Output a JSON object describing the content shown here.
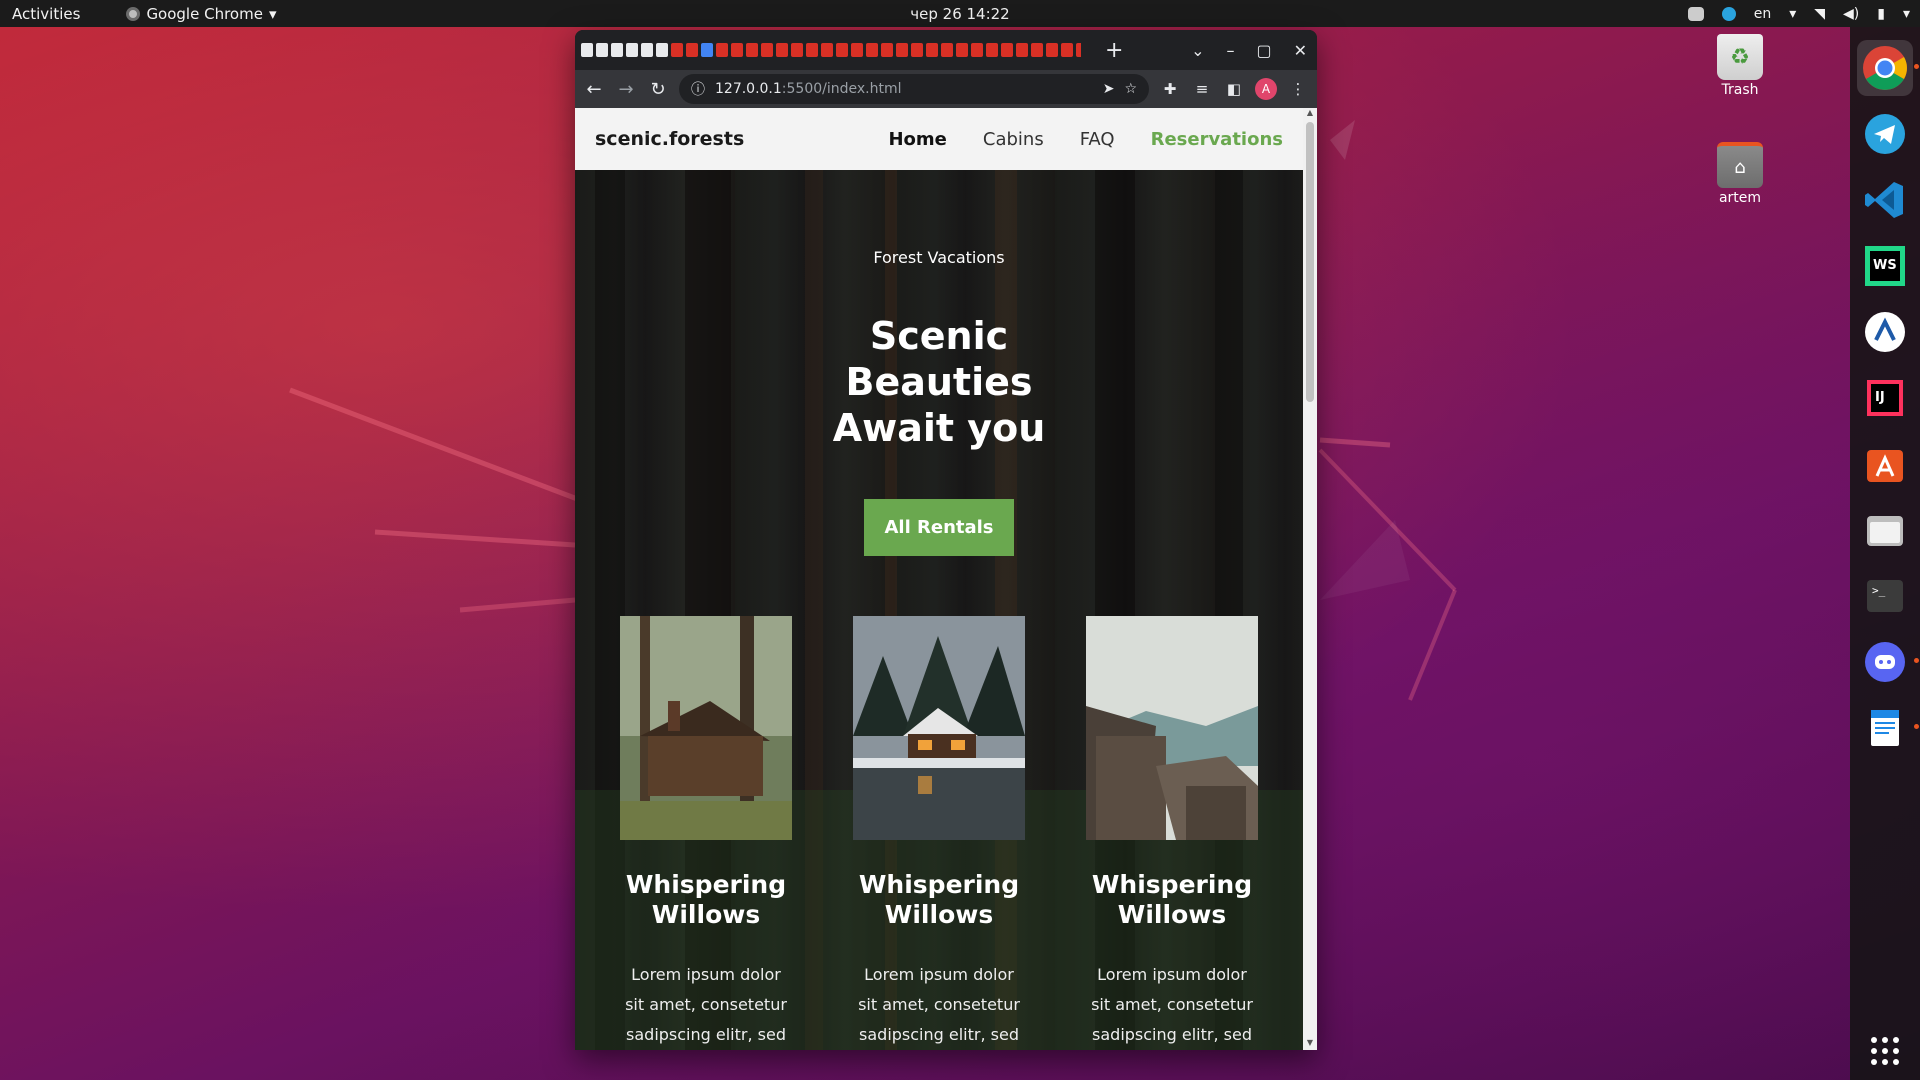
{
  "system": {
    "activities": "Activities",
    "app_menu": "Google Chrome",
    "clock": "чер 26  14:22",
    "lang": "en"
  },
  "desktop": {
    "trash_label": "Trash",
    "home_label": "artem"
  },
  "dock": {
    "items": [
      "chrome-icon",
      "telegram-icon",
      "vscode-icon",
      "webstorm-icon",
      "writer-icon",
      "intellij-icon",
      "app-center-icon",
      "files-icon",
      "terminal-icon",
      "discord-icon",
      "document-icon"
    ]
  },
  "browser": {
    "url_host": "127.0.0.1",
    "url_path": ":5500/index.html",
    "avatar_letter": "A"
  },
  "site": {
    "logo": "scenic.forests",
    "nav": {
      "home": "Home",
      "cabins": "Cabins",
      "faq": "FAQ",
      "reservations": "Reservations"
    },
    "hero": {
      "subtitle": "Forest Vacations",
      "title": "Scenic Beauties Await you",
      "button": "All Rentals"
    },
    "cards": [
      {
        "title": "Whispering Willows",
        "text": "Lorem ipsum dolor sit amet, consetetur sadipscing elitr, sed"
      },
      {
        "title": "Whispering Willows",
        "text": "Lorem ipsum dolor sit amet, consetetur sadipscing elitr, sed"
      },
      {
        "title": "Whispering Willows",
        "text": "Lorem ipsum dolor sit amet, consetetur sadipscing elitr, sed"
      }
    ]
  },
  "colors": {
    "accent": "#6aa84f",
    "header_bg": "#f3f3f3"
  }
}
